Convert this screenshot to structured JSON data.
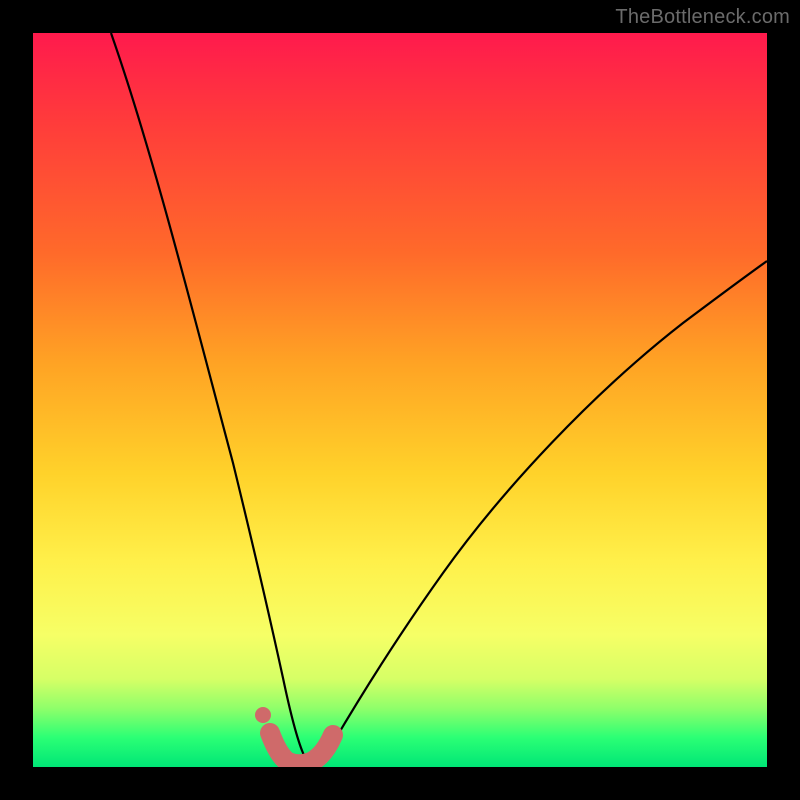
{
  "watermark": "TheBottleneck.com",
  "chart_data": {
    "type": "line",
    "title": "",
    "xlabel": "",
    "ylabel": "",
    "xlim": [
      0,
      100
    ],
    "ylim": [
      0,
      100
    ],
    "annotations": [],
    "series": [
      {
        "name": "bottleneck-curve",
        "x": [
          0,
          3,
          6,
          9,
          12,
          15,
          18,
          21,
          24,
          26,
          28,
          30,
          32,
          34,
          35,
          37,
          40,
          45,
          50,
          55,
          60,
          70,
          80,
          90,
          100
        ],
        "y": [
          110,
          102,
          93,
          85,
          77,
          68,
          60,
          51,
          42,
          33,
          25,
          17,
          10,
          4,
          1,
          1,
          4,
          11,
          19,
          27,
          34,
          47,
          58,
          67,
          75
        ]
      },
      {
        "name": "highlight-band",
        "x": [
          28,
          30,
          32,
          34,
          35,
          37,
          39
        ],
        "y": [
          4,
          2,
          1,
          0.5,
          0.5,
          1,
          3
        ]
      },
      {
        "name": "highlight-dot",
        "x": [
          28
        ],
        "y": [
          7
        ]
      }
    ],
    "background_gradient": {
      "top": "#ff1a4d",
      "mid_upper": "#ffa324",
      "mid_lower": "#fff04a",
      "bottom": "#00e676"
    },
    "highlight_color": "#d46a6a",
    "curve_color": "#000000"
  }
}
